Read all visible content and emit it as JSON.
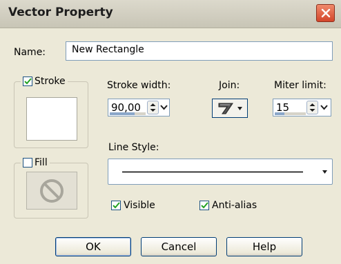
{
  "dialog": {
    "title": "Vector Property",
    "close_icon": "close-icon",
    "name_label": "Name:",
    "name_value": "New Rectangle"
  },
  "stroke": {
    "label": "Stroke",
    "checked": true,
    "width_label": "Stroke width:",
    "width_value": "90,00",
    "join_label": "Join:",
    "join_icon": "miter-join-icon",
    "miter_label": "Miter limit:",
    "miter_value": "15"
  },
  "fill": {
    "label": "Fill",
    "checked": false,
    "swatch_icon": "no-fill-icon"
  },
  "line_style": {
    "label": "Line Style:",
    "value_icon": "solid-line-icon"
  },
  "options": {
    "visible_label": "Visible",
    "visible_checked": true,
    "antialias_label": "Anti-alias",
    "antialias_checked": true
  },
  "buttons": {
    "ok": "OK",
    "cancel": "Cancel",
    "help": "Help"
  },
  "colors": {
    "dialog_bg": "#ece9d8",
    "border_blue": "#003c74",
    "check_green": "#21a121",
    "close_red": "#d3452a"
  }
}
